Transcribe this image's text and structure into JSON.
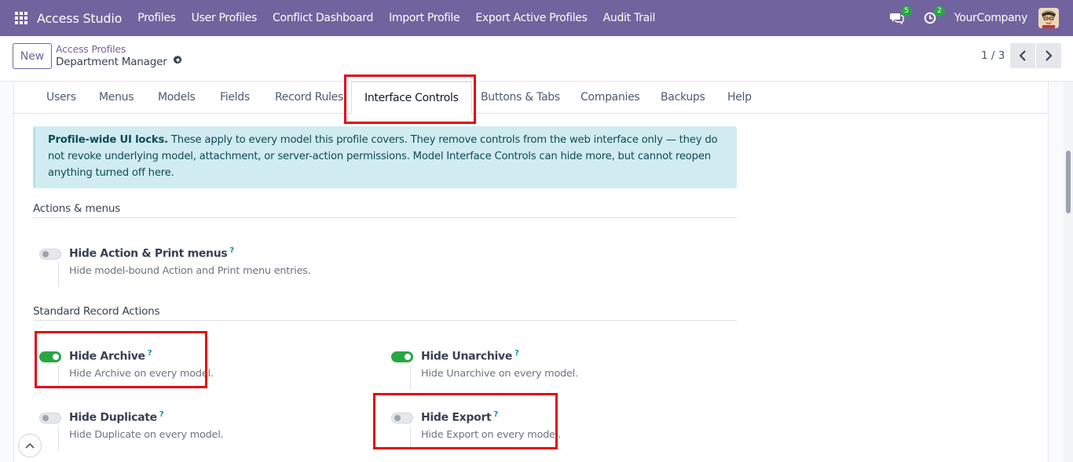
{
  "topbar": {
    "brand": "Access Studio",
    "menu": [
      "Profiles",
      "User Profiles",
      "Conflict Dashboard",
      "Import Profile",
      "Export Active Profiles",
      "Audit Trail"
    ],
    "messages_count": "5",
    "activities_count": "2",
    "company": "YourCompany"
  },
  "control": {
    "new_label": "New",
    "breadcrumb_parent": "Access Profiles",
    "breadcrumb_current": "Department Manager",
    "pager": "1 / 3"
  },
  "tabs": [
    "Users",
    "Menus",
    "Models",
    "Fields",
    "Record Rules",
    "Interface Controls",
    "Buttons & Tabs",
    "Companies",
    "Backups",
    "Help"
  ],
  "active_tab": "Interface Controls",
  "alert": {
    "bold": "Profile-wide UI locks.",
    "text": " These apply to every model this profile covers. They remove controls from the web interface only — they do not revoke underlying model, attachment, or server-action permissions. Model Interface Controls can hide more, but cannot reopen anything turned off here."
  },
  "sections": {
    "actions_menus": "Actions & menus",
    "standard_actions": "Standard Record Actions"
  },
  "settings": {
    "hide_action_print": {
      "title": "Hide Action & Print menus",
      "help": "?",
      "desc": "Hide model-bound Action and Print menu entries.",
      "enabled": false
    },
    "hide_archive": {
      "title": "Hide Archive",
      "help": "?",
      "desc": "Hide Archive on every model.",
      "enabled": true
    },
    "hide_unarchive": {
      "title": "Hide Unarchive",
      "help": "?",
      "desc": "Hide Unarchive on every model.",
      "enabled": true
    },
    "hide_duplicate": {
      "title": "Hide Duplicate",
      "help": "?",
      "desc": "Hide Duplicate on every model.",
      "enabled": false
    },
    "hide_export": {
      "title": "Hide Export",
      "help": "?",
      "desc": "Hide Export on every model.",
      "enabled": false
    }
  },
  "colors": {
    "topbar": "#71639e",
    "toggle_on": "#28a745",
    "highlight": "#e30613",
    "alert_bg": "#d0ecf1"
  }
}
